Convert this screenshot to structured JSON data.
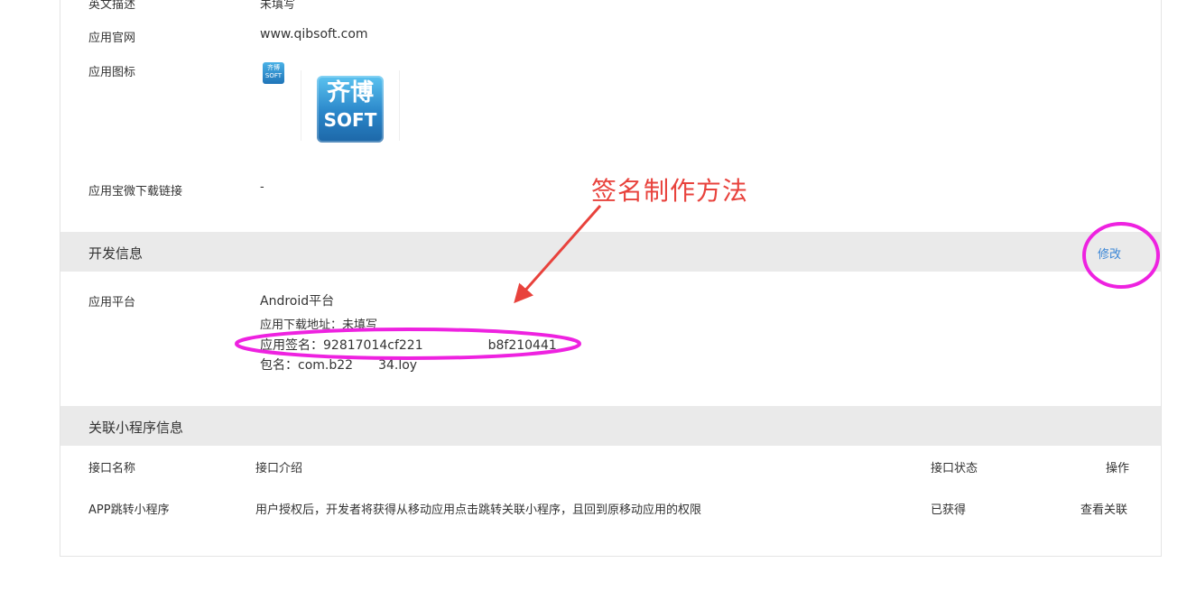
{
  "basic": {
    "english_desc_label": "英文描述",
    "english_desc_value": "未填写",
    "website_label": "应用官网",
    "website_value": "www.qibsoft.com",
    "icon_label": "应用图标",
    "icon_text_cn": "齐博",
    "icon_text_en": "SOFT",
    "yyb_label": "应用宝微下载链接",
    "yyb_value": "-"
  },
  "dev_section": {
    "title": "开发信息",
    "edit_link": "修改",
    "platform_label": "应用平台",
    "platform_value": "Android平台",
    "download_line": "应用下载地址：未填写",
    "signature_prefix": "应用签名：",
    "signature_part1": "92817014cf221",
    "signature_part2": "b8f210441",
    "package_prefix": "包名：",
    "package_part1": "com.b22",
    "package_part2": "34.loy"
  },
  "annotation": {
    "text": "签名制作方法",
    "color": "#e8423c",
    "circle_color": "#ee22e0"
  },
  "mini_section": {
    "title": "关联小程序信息",
    "columns": [
      "接口名称",
      "接口介绍",
      "接口状态",
      "操作"
    ],
    "rows": [
      {
        "name": "APP跳转小程序",
        "desc": "用户授权后，开发者将获得从移动应用点击跳转关联小程序，且回到原移动应用的权限",
        "status": "已获得",
        "action": "查看关联"
      }
    ]
  },
  "colors": {
    "link": "#3a86d6",
    "section_bg": "#eaeaea"
  }
}
